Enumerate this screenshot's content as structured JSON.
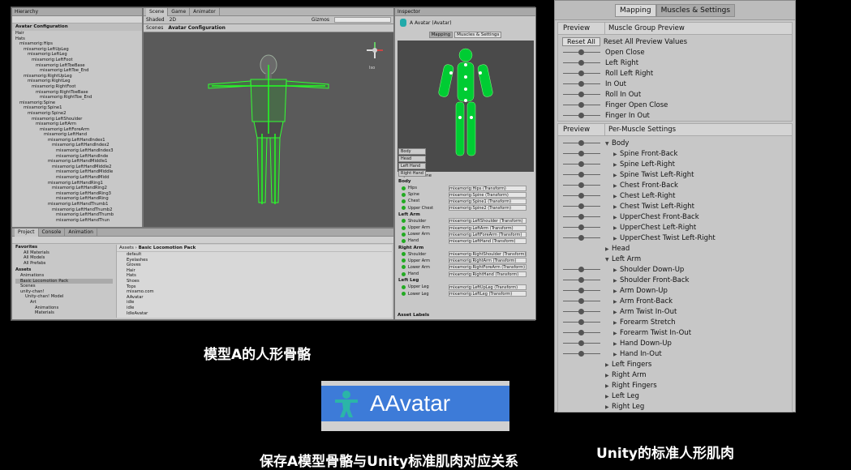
{
  "captions": {
    "model_a": "模型A的人形骨骼",
    "save_relation": "保存A模型骨骼与Unity标准肌肉对应关系",
    "unity_muscle": "Unity的标准人形肌肉"
  },
  "avatar_chip": {
    "label": "AAvatar"
  },
  "hierarchy": {
    "tab": "Hierarchy",
    "root": "Avatar Configuration",
    "items": [
      "Hair",
      "Hats",
      "mixamorig:Hips",
      "mixamorig:LeftUpLeg",
      "mixamorig:LeftLeg",
      "mixamorig:LeftFoot",
      "mixamorig:LeftToeBase",
      "mixamorig:LeftToe_End",
      "mixamorig:RightUpLeg",
      "mixamorig:RightLeg",
      "mixamorig:RightFoot",
      "mixamorig:RightToeBase",
      "mixamorig:RightToe_End",
      "mixamorig:Spine",
      "mixamorig:Spine1",
      "mixamorig:Spine2",
      "mixamorig:LeftShoulder",
      "mixamorig:LeftArm",
      "mixamorig:LeftForeArm",
      "mixamorig:LeftHand",
      "mixamorig:LeftHandIndex1",
      "mixamorig:LeftHandIndex2",
      "mixamorig:LeftHandIndex3",
      "mixamorig:LeftHandInde",
      "mixamorig:LeftHandMiddle1",
      "mixamorig:LeftHandMiddle2",
      "mixamorig:LeftHandMiddle",
      "mixamorig:LeftHandMidd",
      "mixamorig:LeftHandRing1",
      "mixamorig:LeftHandRing2",
      "mixamorig:LeftHandRing3",
      "mixamorig:LeftHandRing",
      "mixamorig:LeftHandThumb1",
      "mixamorig:LeftHandThumb2",
      "mixamorig:LeftHandThumb",
      "mixamorig:LeftHandThun"
    ]
  },
  "scene": {
    "tabs": [
      "Scene",
      "Game",
      "Animator"
    ],
    "shading": "Shaded",
    "mode": "2D",
    "gizmos": "Gizmos",
    "breadcrumb_scenes": "Scenes",
    "breadcrumb_config": "Avatar Configuration",
    "persp": "Iso"
  },
  "project": {
    "tabs": [
      "Project",
      "Console",
      "Animation"
    ],
    "favorites_label": "Favorites",
    "favorites": [
      "All Materials",
      "All Models",
      "All Prefabs"
    ],
    "assets_label": "Assets",
    "asset_tree": [
      "Animations",
      "Basic Locomotion Pack",
      "Scenes",
      "unity-chan!",
      "Unity-chan! Model",
      "Art",
      "Animations",
      "Materials"
    ],
    "path": [
      "Assets",
      "Basic Locomotion Pack"
    ],
    "files": [
      "default",
      "Eyelashes",
      "Gloves",
      "Hair",
      "Hats",
      "Shoes",
      "Tops",
      "mixamo.com",
      "AAvatar",
      "idle",
      "idle",
      "IdleAvatar"
    ]
  },
  "inspector": {
    "tab": "Inspector",
    "title": "A Avatar (Avatar)",
    "tabs": [
      "Mapping",
      "Muscles & Settings"
    ],
    "body_buttons": [
      "Body",
      "Head",
      "Left Hand",
      "Right Hand"
    ],
    "optional_bone": "Optional Bone",
    "groups": [
      {
        "name": "Body",
        "rows": [
          [
            "Hips",
            "mixamorig:Hips (Transform)"
          ],
          [
            "Spine",
            "mixamorig:Spine (Transform)"
          ],
          [
            "Chest",
            "mixamorig:Spine1 (Transform)"
          ],
          [
            "Upper Chest",
            "mixamorig:Spine2 (Transform)"
          ]
        ]
      },
      {
        "name": "Left Arm",
        "rows": [
          [
            "Shoulder",
            "mixamorig:LeftShoulder (Transform)"
          ],
          [
            "Upper Arm",
            "mixamorig:LeftArm (Transform)"
          ],
          [
            "Lower Arm",
            "mixamorig:LeftForeArm (Transform)"
          ],
          [
            "Hand",
            "mixamorig:LeftHand (Transform)"
          ]
        ]
      },
      {
        "name": "Right Arm",
        "rows": [
          [
            "Shoulder",
            "mixamorig:RightShoulder (Transform)"
          ],
          [
            "Upper Arm",
            "mixamorig:RightArm (Transform)"
          ],
          [
            "Lower Arm",
            "mixamorig:RightForeArm (Transform)"
          ],
          [
            "Hand",
            "mixamorig:RightHand (Transform)"
          ]
        ]
      },
      {
        "name": "Left Leg",
        "rows": [
          [
            "Upper Leg",
            "mixamorig:LeftUpLeg (Transform)"
          ],
          [
            "Lower Leg",
            "mixamorig:LeftLeg (Transform)"
          ]
        ]
      }
    ],
    "asset_labels": "Asset Labels"
  },
  "muscles": {
    "tabs": [
      "Mapping",
      "Muscles & Settings"
    ],
    "preview_label": "Preview",
    "group_preview_title": "Muscle Group Preview",
    "reset_button": "Reset All",
    "reset_label": "Reset All Preview Values",
    "group_rows": [
      "Open Close",
      "Left Right",
      "Roll Left Right",
      "In Out",
      "Roll In Out",
      "Finger Open Close",
      "Finger In Out"
    ],
    "per_muscle_title": "Per-Muscle Settings",
    "tree": [
      {
        "label": "Body",
        "level": 0,
        "open": true,
        "slider": true
      },
      {
        "label": "Spine Front-Back",
        "level": 1,
        "slider": true
      },
      {
        "label": "Spine Left-Right",
        "level": 1,
        "slider": true
      },
      {
        "label": "Spine Twist Left-Right",
        "level": 1,
        "slider": true
      },
      {
        "label": "Chest Front-Back",
        "level": 1,
        "slider": true
      },
      {
        "label": "Chest Left-Right",
        "level": 1,
        "slider": true
      },
      {
        "label": "Chest Twist Left-Right",
        "level": 1,
        "slider": true
      },
      {
        "label": "UpperChest Front-Back",
        "level": 1,
        "slider": true
      },
      {
        "label": "UpperChest Left-Right",
        "level": 1,
        "slider": true
      },
      {
        "label": "UpperChest Twist Left-Right",
        "level": 1,
        "slider": true
      },
      {
        "label": "Head",
        "level": 0,
        "open": false,
        "slider": false
      },
      {
        "label": "Left Arm",
        "level": 0,
        "open": true,
        "slider": false
      },
      {
        "label": "Shoulder Down-Up",
        "level": 1,
        "slider": true
      },
      {
        "label": "Shoulder Front-Back",
        "level": 1,
        "slider": true
      },
      {
        "label": "Arm Down-Up",
        "level": 1,
        "slider": true
      },
      {
        "label": "Arm Front-Back",
        "level": 1,
        "slider": true
      },
      {
        "label": "Arm Twist In-Out",
        "level": 1,
        "slider": true
      },
      {
        "label": "Forearm Stretch",
        "level": 1,
        "slider": true
      },
      {
        "label": "Forearm Twist In-Out",
        "level": 1,
        "slider": true
      },
      {
        "label": "Hand Down-Up",
        "level": 1,
        "slider": true
      },
      {
        "label": "Hand In-Out",
        "level": 1,
        "slider": true
      },
      {
        "label": "Left Fingers",
        "level": 0,
        "open": false,
        "slider": false
      },
      {
        "label": "Right Arm",
        "level": 0,
        "open": false,
        "slider": false
      },
      {
        "label": "Right Fingers",
        "level": 0,
        "open": false,
        "slider": false
      },
      {
        "label": "Left Leg",
        "level": 0,
        "open": false,
        "slider": false
      },
      {
        "label": "Right Leg",
        "level": 0,
        "open": false,
        "slider": false
      }
    ]
  }
}
